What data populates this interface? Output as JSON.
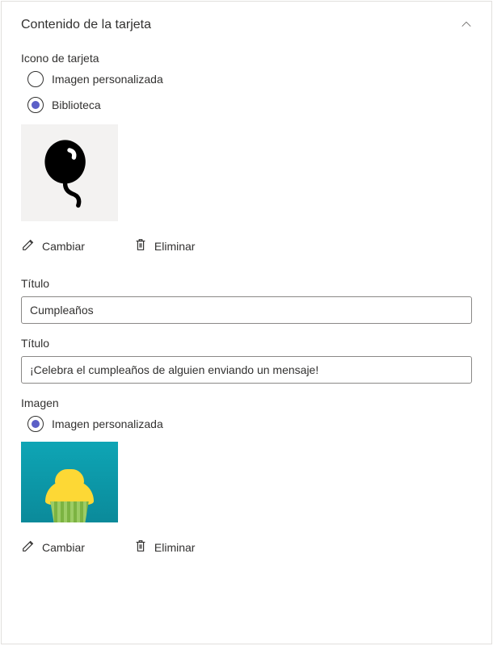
{
  "header": {
    "title": "Contenido de la tarjeta"
  },
  "iconSection": {
    "label": "Icono de tarjeta",
    "options": {
      "custom": "Imagen personalizada",
      "library": "Biblioteca"
    },
    "changeLabel": "Cambiar",
    "deleteLabel": "Eliminar"
  },
  "titleField": {
    "label": "Título",
    "value": "Cumpleaños"
  },
  "subtitleField": {
    "label": "Título",
    "value": "¡Celebra el cumpleaños de alguien enviando un mensaje!"
  },
  "imageSection": {
    "label": "Imagen",
    "options": {
      "custom": "Imagen personalizada"
    },
    "changeLabel": "Cambiar",
    "deleteLabel": "Eliminar"
  }
}
